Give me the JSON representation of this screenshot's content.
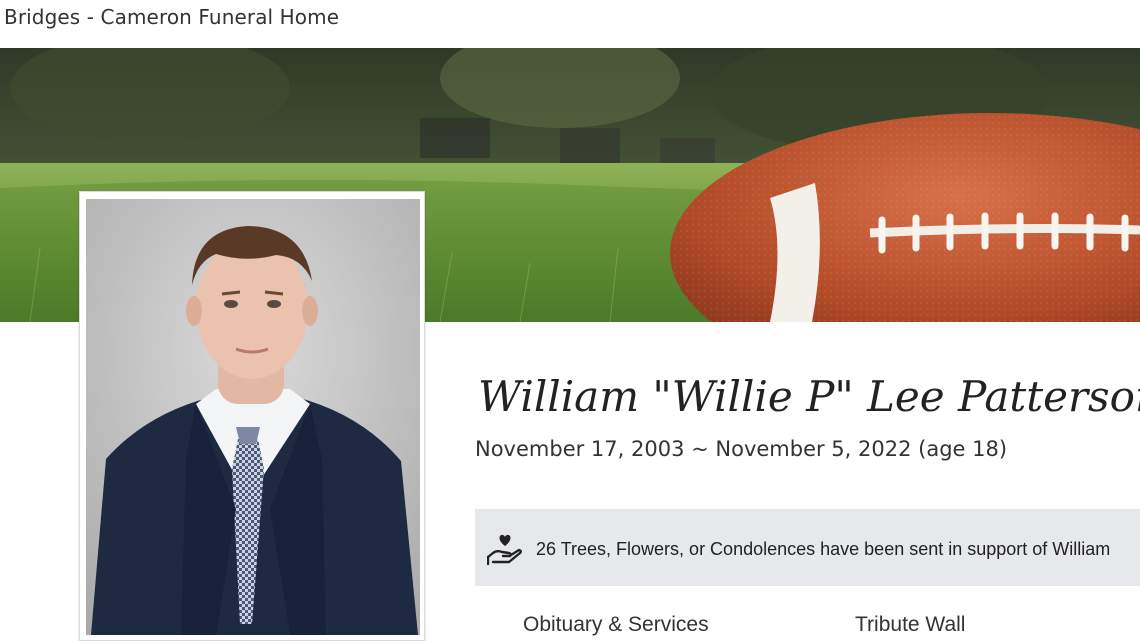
{
  "header": {
    "site_title": "Bridges - Cameron Funeral Home"
  },
  "banner": {
    "image": "football-on-grass"
  },
  "portrait": {
    "image": "young-man-in-navy-suit"
  },
  "obituary": {
    "name": "William \"Willie P\" Lee Patterson",
    "dates": "November 17, 2003 ~ November 5, 2022 (age 18)"
  },
  "support": {
    "icon": "hand-heart-icon",
    "text": "26 Trees, Flowers, or Condolences have been sent in support of William"
  },
  "tabs": [
    {
      "label": "Obituary & Services"
    },
    {
      "label": "Tribute Wall"
    }
  ]
}
